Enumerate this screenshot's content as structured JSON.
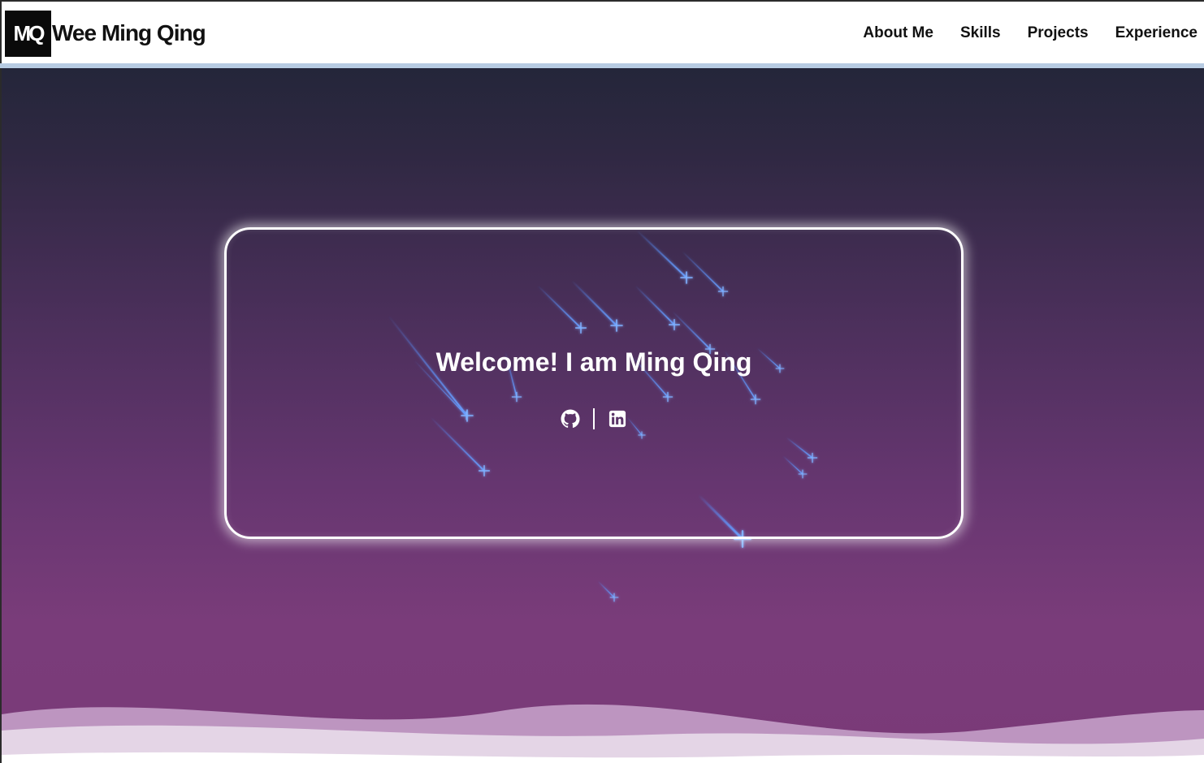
{
  "header": {
    "logo_text": "MQ",
    "brand_name": "Wee Ming Qing",
    "nav": [
      {
        "label": "About Me"
      },
      {
        "label": "Skills"
      },
      {
        "label": "Projects"
      },
      {
        "label": "Experience"
      }
    ]
  },
  "hero": {
    "title": "Welcome! I am Ming Qing",
    "social_links": [
      {
        "icon": "github-icon"
      },
      {
        "icon": "linkedin-icon"
      }
    ]
  },
  "colors": {
    "nav_underline": "#b7cbe2",
    "hero_top": "#24263a",
    "hero_bottom": "#7a3a78",
    "meteor": "#4f8cff"
  }
}
